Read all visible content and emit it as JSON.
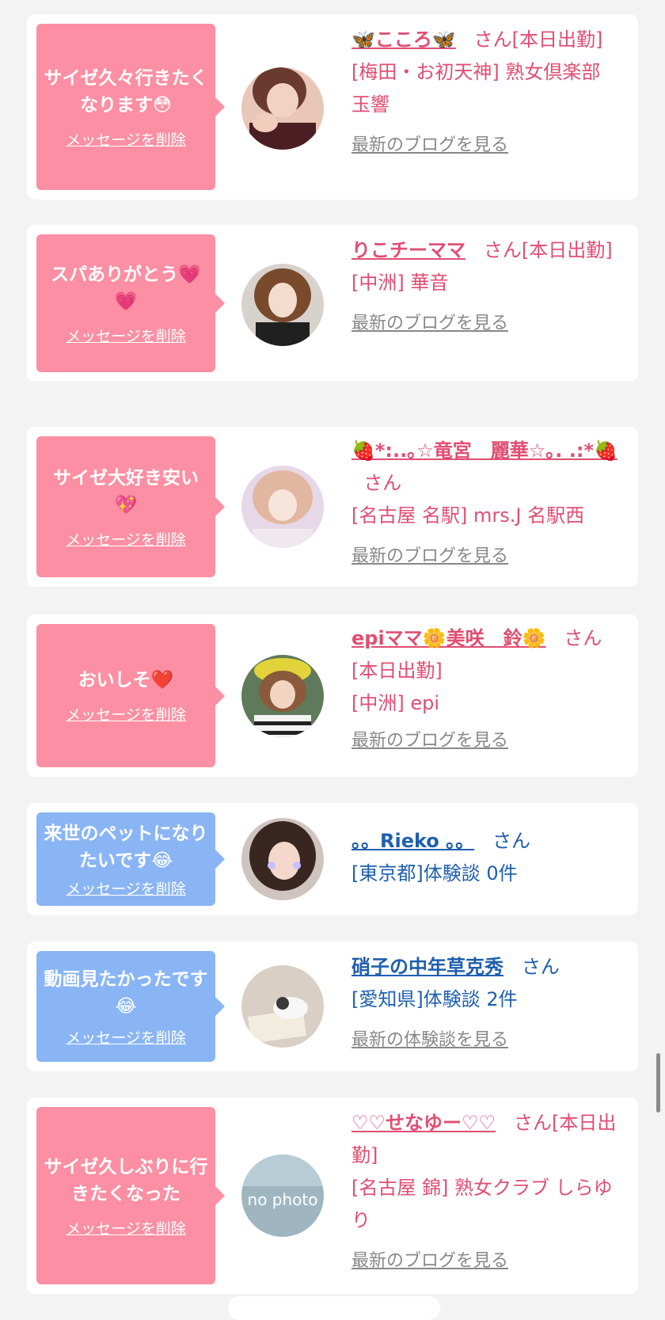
{
  "colors": {
    "pink_bubble": "#fc8fa3",
    "blue_bubble": "#8ab5f5",
    "pink_text": "#e04e72",
    "blue_text": "#1f5fae"
  },
  "delete_label": "メッセージを削除",
  "cards": [
    {
      "message": "サイゼ久々行きたくなります😳",
      "name": "🦋こころ🦋",
      "san": "さん",
      "status": "[本日出勤]",
      "shop": "[梅田・お初天神] 熟女倶楽部 玉響",
      "link": "最新のブログを見る"
    },
    {
      "message": "スパありがとう💗💗",
      "name": "りこチーママ",
      "san": "さん",
      "status": "[本日出勤]",
      "shop": "[中洲] 華音",
      "link": "最新のブログを見る"
    },
    {
      "message": "サイゼ大好き安い💖",
      "name": "🍓*:..｡☆竜宮　麗華☆｡. .:*🍓",
      "san": "さん",
      "shop": "[名古屋 名駅] mrs.J 名駅西",
      "link": "最新のブログを見る"
    },
    {
      "message": "おいしそ❤️",
      "name": "epiママ🌼美咲　鈴🌼",
      "san": "さん",
      "status": "[本日出勤]",
      "shop": "[中洲] epi",
      "link": "最新のブログを見る"
    },
    {
      "message": "来世のペットになりたいです😂",
      "name": "。。Rieko 。。",
      "san": "さん",
      "shop": "[東京都]体験談 0件"
    },
    {
      "message": "動画見たかったです😂",
      "name": "硝子の中年草克秀",
      "san": "さん",
      "shop": "[愛知県]体験談 2件",
      "link": "最新の体験談を見る"
    },
    {
      "message": "サイゼ久しぶりに行きたくなった",
      "name": "♡♡せなゆー♡♡",
      "san": "さん",
      "status": "[本日出勤]",
      "shop": "[名古屋 錦] 熟女クラブ しらゆり",
      "link": "最新のブログを見る",
      "avatar_text": "no photo"
    }
  ]
}
